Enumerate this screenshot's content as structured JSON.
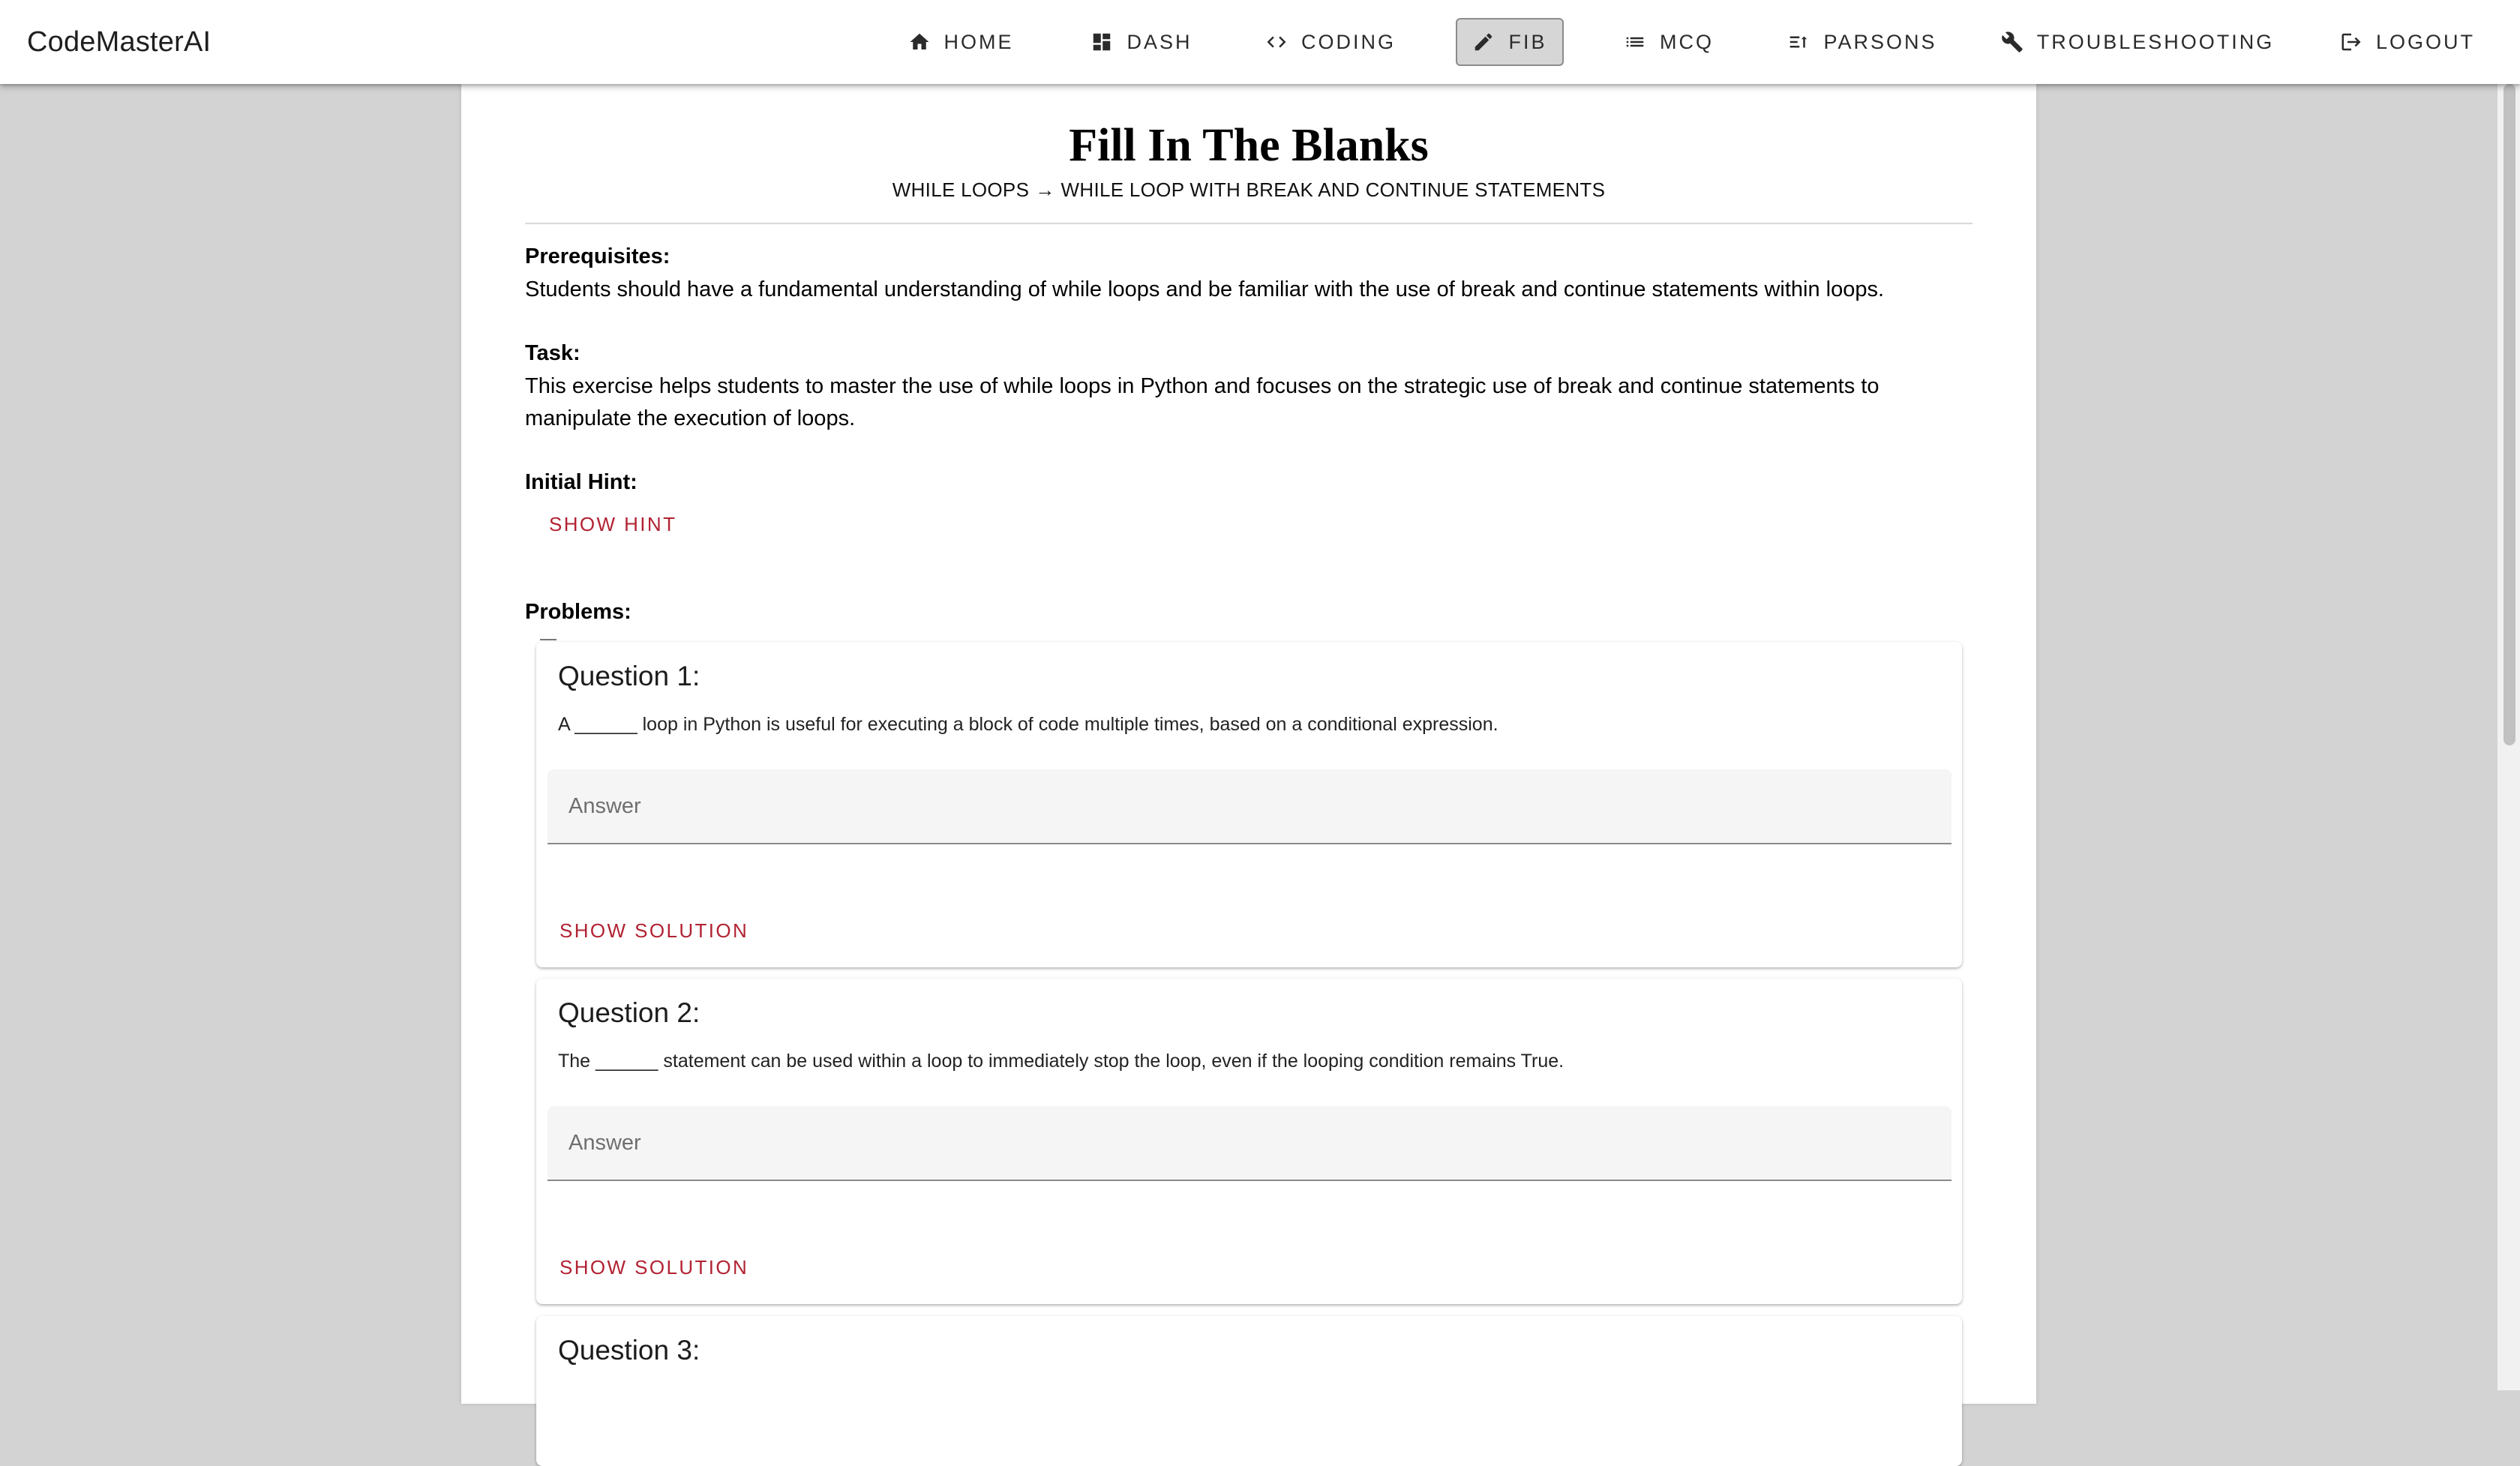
{
  "app": {
    "brand": "CodeMasterAI"
  },
  "nav": {
    "home": "HOME",
    "dash": "DASH",
    "coding": "CODING",
    "fib": "FIB",
    "mcq": "MCQ",
    "parsons": "PARSONS",
    "troubleshooting": "TROUBLESHOOTING",
    "logout": "LOGOUT",
    "active": "FIB"
  },
  "page": {
    "title": "Fill In The Blanks",
    "breadcrumb": {
      "topic": "WHILE LOOPS",
      "separator": "→",
      "subtopic": "WHILE LOOP WITH BREAK AND CONTINUE STATEMENTS"
    }
  },
  "prerequisites": {
    "label": "Prerequisites:",
    "text": "Students should have a fundamental understanding of while loops and be familiar with the use of break and continue statements within loops."
  },
  "task": {
    "label": "Task:",
    "text": "This exercise helps students to master the use of while loops in Python and focuses on the strategic use of break and continue statements to manipulate the execution of loops."
  },
  "hint": {
    "label": "Initial Hint:",
    "button": "SHOW HINT"
  },
  "problems": {
    "label": "Problems:",
    "questions": [
      {
        "title": "Question 1:",
        "text": "A ______ loop in Python is useful for executing a block of code multiple times, based on a conditional expression.",
        "answer_placeholder": "Answer",
        "answer_value": "",
        "solution_button": "SHOW SOLUTION"
      },
      {
        "title": "Question 2:",
        "text": "The ______ statement can be used within a loop to immediately stop the loop, even if the looping condition remains True.",
        "answer_placeholder": "Answer",
        "answer_value": "",
        "solution_button": "SHOW SOLUTION"
      },
      {
        "title": "Question 3:"
      }
    ]
  },
  "colors": {
    "accent": "#b22232",
    "background": "#d3d3d3",
    "appbar": "#ffffff",
    "active_nav": "#d6d6d6"
  }
}
